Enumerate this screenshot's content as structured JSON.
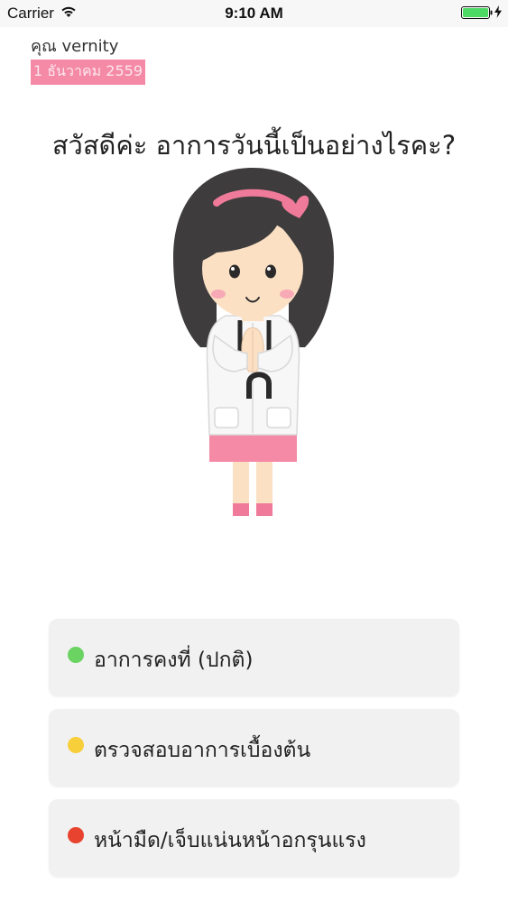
{
  "status_bar": {
    "carrier": "Carrier",
    "time": "9:10 AM",
    "icons": [
      "wifi-icon",
      "battery-icon",
      "charging-icon"
    ],
    "battery_color": "#4cd964"
  },
  "header": {
    "user_name": "คุณ vernity",
    "date": "1 ธันวาคม 2559",
    "date_badge_color": "#f48aa6"
  },
  "greeting": "สวัสดีค่ะ อาการวันนี้เป็นอย่างไรคะ?",
  "illustration": "nurse-character",
  "options": [
    {
      "label": "อาการคงที่ (ปกติ)",
      "dot_color": "#6ad362"
    },
    {
      "label": "ตรวจสอบอาการเบื้องต้น",
      "dot_color": "#f7cf3b"
    },
    {
      "label": "หน้ามืด/เจ็บแน่นหน้าอกรุนแรง",
      "dot_color": "#e8432e"
    }
  ]
}
